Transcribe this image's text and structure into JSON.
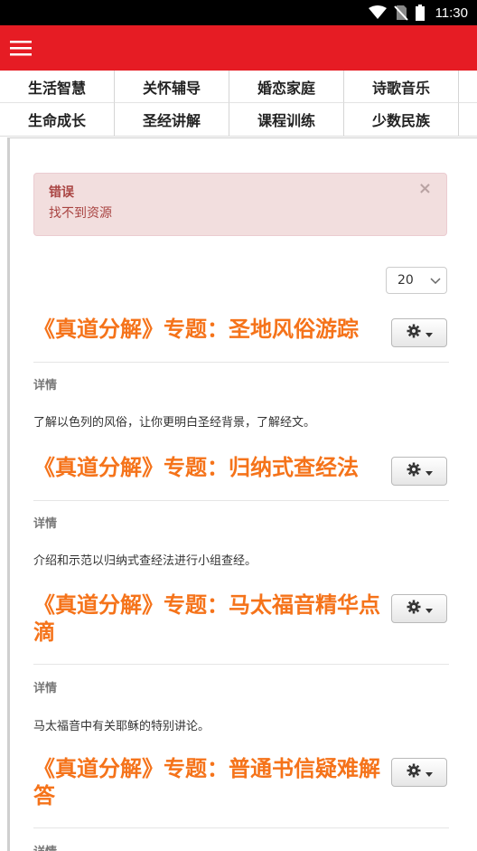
{
  "status_bar": {
    "time": "11:30",
    "icons": [
      "wifi-icon",
      "no-sim-icon",
      "battery-icon"
    ]
  },
  "app_bar": {
    "menu_icon": "hamburger-menu-icon",
    "color": "#e61c24"
  },
  "categories": [
    {
      "label": "生活智慧"
    },
    {
      "label": "关怀辅导"
    },
    {
      "label": "婚恋家庭"
    },
    {
      "label": "诗歌音乐"
    },
    {
      "label": "生命成长"
    },
    {
      "label": "圣经讲解"
    },
    {
      "label": "课程训练"
    },
    {
      "label": "少数民族"
    }
  ],
  "alert": {
    "title": "错误",
    "message": "找不到资源",
    "close": "×"
  },
  "page_size": {
    "value": "20"
  },
  "items": [
    {
      "title": "《真道分解》专题：圣地风俗游踪",
      "detail_label": "详情",
      "description": "了解以色列的风俗，让你更明白圣经背景，了解经文。"
    },
    {
      "title": "《真道分解》专题：归纳式查经法",
      "detail_label": "详情",
      "description": "介绍和示范以归纳式查经法进行小组查经。"
    },
    {
      "title": "《真道分解》专题：马太福音精华点滴",
      "detail_label": "详情",
      "description": "马太福音中有关耶稣的特别讲论。"
    },
    {
      "title": "《真道分解》专题：普通书信疑难解答",
      "detail_label": "详情",
      "description": ""
    }
  ],
  "colors": {
    "title_orange": "#f5731a",
    "alert_text": "#a94442",
    "alert_bg": "#f2dede"
  }
}
